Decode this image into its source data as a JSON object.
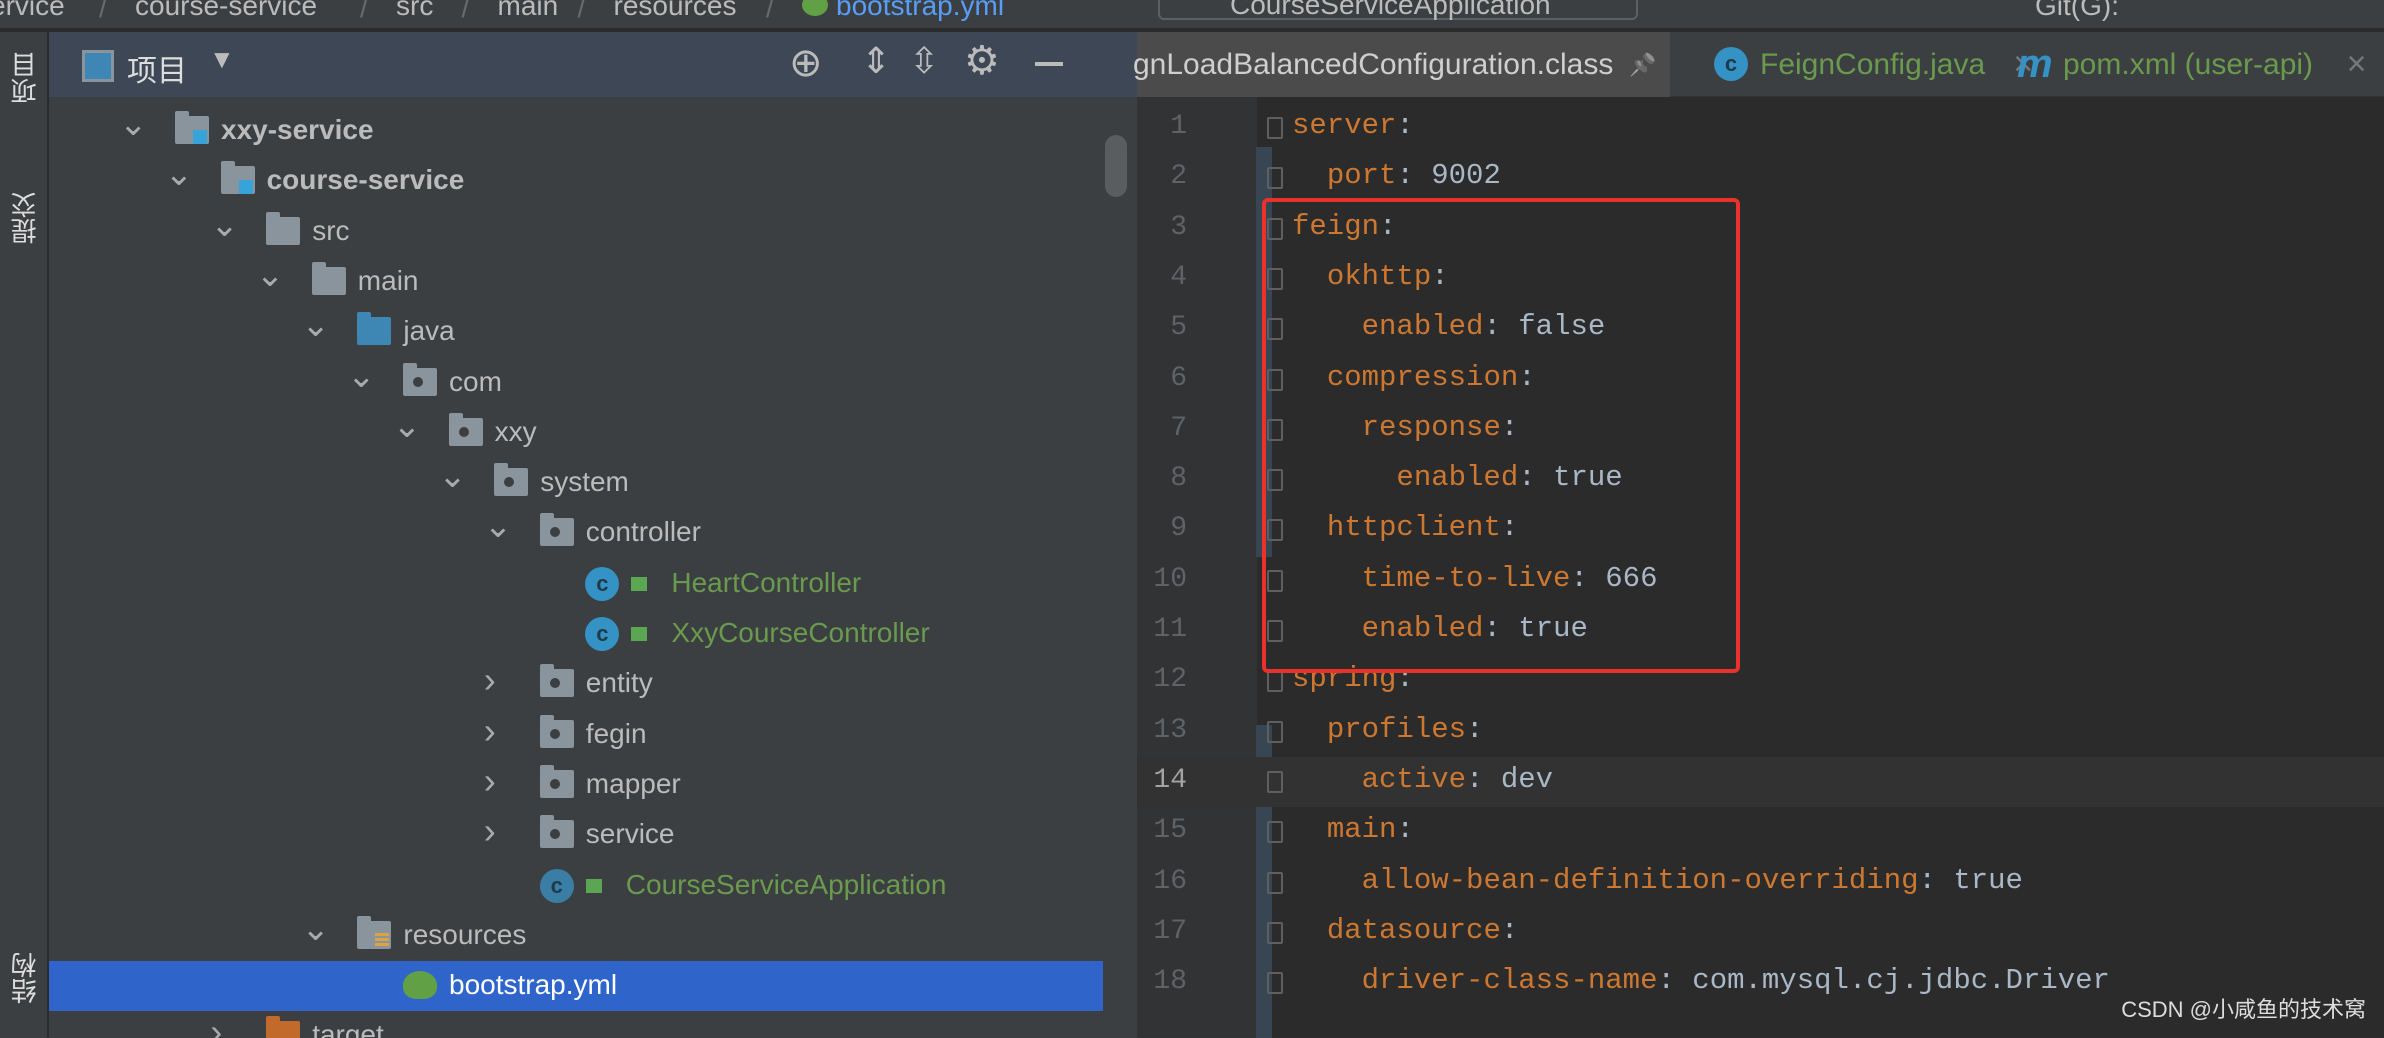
{
  "breadcrumb": [
    "ervice",
    "course-service",
    "src",
    "main",
    "resources",
    "bootstrap.yml"
  ],
  "run_config": "CourseServiceApplication",
  "vcs_label": "Git(G):",
  "left_strip": {
    "project": "项目",
    "commit": "提交",
    "structure": "结构"
  },
  "project_panel": {
    "title": "项目",
    "icons": [
      "locate-icon",
      "expand-all-icon",
      "collapse-all-icon",
      "gear-icon",
      "minimize-icon"
    ]
  },
  "tree": [
    {
      "level": 0,
      "label": "xxy-service",
      "icon": "module",
      "expanded": true,
      "bold": true
    },
    {
      "level": 1,
      "label": "course-service",
      "icon": "module",
      "expanded": true,
      "bold": true
    },
    {
      "level": 2,
      "label": "src",
      "icon": "folder",
      "expanded": true
    },
    {
      "level": 3,
      "label": "main",
      "icon": "folder",
      "expanded": true
    },
    {
      "level": 4,
      "label": "java",
      "icon": "source-folder",
      "expanded": true
    },
    {
      "level": 5,
      "label": "com",
      "icon": "package",
      "expanded": true
    },
    {
      "level": 6,
      "label": "xxy",
      "icon": "package",
      "expanded": true
    },
    {
      "level": 7,
      "label": "system",
      "icon": "package",
      "expanded": true
    },
    {
      "level": 8,
      "label": "controller",
      "icon": "package",
      "expanded": true
    },
    {
      "level": 9,
      "label": "HeartController",
      "icon": "class",
      "leaf": true
    },
    {
      "level": 9,
      "label": "XxyCourseController",
      "icon": "class",
      "leaf": true
    },
    {
      "level": 8,
      "label": "entity",
      "icon": "package",
      "expanded": false
    },
    {
      "level": 8,
      "label": "fegin",
      "icon": "package",
      "expanded": false
    },
    {
      "level": 8,
      "label": "mapper",
      "icon": "package",
      "expanded": false
    },
    {
      "level": 8,
      "label": "service",
      "icon": "package",
      "expanded": false
    },
    {
      "level": 8,
      "label": "CourseServiceApplication",
      "icon": "spring-boot-class",
      "leaf": true
    },
    {
      "level": 4,
      "label": "resources",
      "icon": "resources-folder",
      "expanded": true
    },
    {
      "level": 5,
      "label": "bootstrap.yml",
      "icon": "yaml",
      "leaf": true,
      "selected": true
    },
    {
      "level": 2,
      "label": "target",
      "icon": "excluded-folder",
      "expanded": false
    }
  ],
  "tabs": [
    {
      "label": "gnLoadBalancedConfiguration.class",
      "active": true,
      "pinned": true
    },
    {
      "label": "FeignConfig.java",
      "icon": "class"
    },
    {
      "label": "pom.xml (user-api)",
      "icon": "maven"
    }
  ],
  "editor": {
    "current_line": 14,
    "lines": [
      {
        "n": 1,
        "indent": 0,
        "key": "server",
        "value": ""
      },
      {
        "n": 2,
        "indent": 1,
        "key": "port",
        "value": "9002"
      },
      {
        "n": 3,
        "indent": 0,
        "key": "feign",
        "value": ""
      },
      {
        "n": 4,
        "indent": 1,
        "key": "okhttp",
        "value": ""
      },
      {
        "n": 5,
        "indent": 2,
        "key": "enabled",
        "value": "false"
      },
      {
        "n": 6,
        "indent": 1,
        "key": "compression",
        "value": ""
      },
      {
        "n": 7,
        "indent": 2,
        "key": "response",
        "value": ""
      },
      {
        "n": 8,
        "indent": 3,
        "key": "enabled",
        "value": "true"
      },
      {
        "n": 9,
        "indent": 1,
        "key": "httpclient",
        "value": ""
      },
      {
        "n": 10,
        "indent": 2,
        "key": "time-to-live",
        "value": "666"
      },
      {
        "n": 11,
        "indent": 2,
        "key": "enabled",
        "value": "true"
      },
      {
        "n": 12,
        "indent": 0,
        "key": "spring",
        "value": ""
      },
      {
        "n": 13,
        "indent": 1,
        "key": "profiles",
        "value": ""
      },
      {
        "n": 14,
        "indent": 2,
        "key": "active",
        "value": "dev"
      },
      {
        "n": 15,
        "indent": 1,
        "key": "main",
        "value": ""
      },
      {
        "n": 16,
        "indent": 2,
        "key": "allow-bean-definition-overriding",
        "value": "true"
      },
      {
        "n": 17,
        "indent": 1,
        "key": "datasource",
        "value": ""
      },
      {
        "n": 18,
        "indent": 2,
        "key": "driver-class-name",
        "value": "com.mysql.cj.jdbc.Driver"
      }
    ]
  },
  "highlight_box": {
    "color": "#e8322b",
    "lines": [
      3,
      11
    ]
  },
  "colors": {
    "key": "#cc7832",
    "value": "#a9b7c6",
    "selection": "#2f65ca",
    "green_file": "#6a9a4e"
  },
  "watermark": "CSDN @小咸鱼的技术窝"
}
